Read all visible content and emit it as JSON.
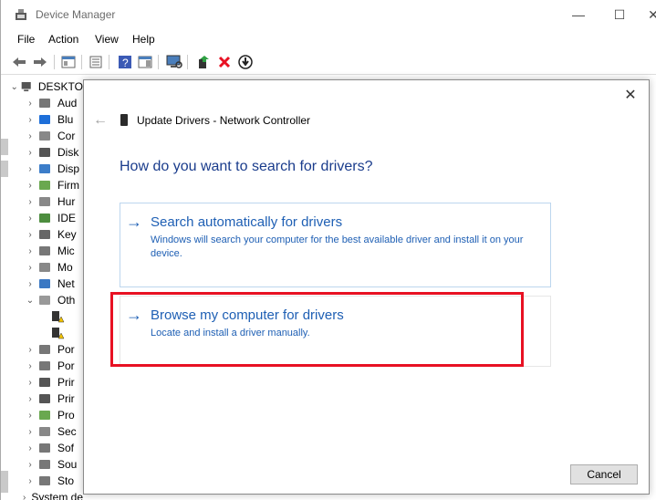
{
  "window": {
    "title": "Device Manager",
    "controls": {
      "minimize": "—",
      "maximize": "☐",
      "close": "✕"
    }
  },
  "menu": [
    "File",
    "Action",
    "View",
    "Help"
  ],
  "tree": {
    "root": "DESKTO",
    "items": [
      {
        "label": "Aud",
        "expanded": false
      },
      {
        "label": "Blu",
        "expanded": false
      },
      {
        "label": "Cor",
        "expanded": false
      },
      {
        "label": "Disk",
        "expanded": false
      },
      {
        "label": "Disp",
        "expanded": false
      },
      {
        "label": "Firm",
        "expanded": false
      },
      {
        "label": "Hur",
        "expanded": false
      },
      {
        "label": "IDE",
        "expanded": false
      },
      {
        "label": "Key",
        "expanded": false
      },
      {
        "label": "Mic",
        "expanded": false
      },
      {
        "label": "Mo",
        "expanded": false
      },
      {
        "label": "Net",
        "expanded": false
      },
      {
        "label": "Oth",
        "expanded": true
      },
      {
        "label": "",
        "child": true
      },
      {
        "label": "",
        "child": true
      },
      {
        "label": "Por",
        "expanded": false
      },
      {
        "label": "Por",
        "expanded": false
      },
      {
        "label": "Prir",
        "expanded": false
      },
      {
        "label": "Prir",
        "expanded": false
      },
      {
        "label": "Pro",
        "expanded": false
      },
      {
        "label": "Sec",
        "expanded": false
      },
      {
        "label": "Sof",
        "expanded": false
      },
      {
        "label": "Sou",
        "expanded": false
      },
      {
        "label": "Sto",
        "expanded": false
      },
      {
        "label": "System devices",
        "expanded": false
      }
    ]
  },
  "dialog": {
    "title": "Update Drivers - Network Controller",
    "heading": "How do you want to search for drivers?",
    "close": "✕",
    "back": "←",
    "options": {
      "auto": {
        "arrow": "→",
        "title": "Search automatically for drivers",
        "desc": "Windows will search your computer for the best available driver and install it on your device."
      },
      "browse": {
        "arrow": "→",
        "title": "Browse my computer for drivers",
        "desc": "Locate and install a driver manually."
      }
    },
    "cancel": "Cancel"
  },
  "colors": {
    "link_blue": "#1e5fb4",
    "highlight_red": "#e81123",
    "heading_blue": "#1a3c8c"
  },
  "icons": [
    "device-manager-icon",
    "back-arrow-icon",
    "forward-arrow-icon",
    "properties-icon",
    "help-icon",
    "scan-icon",
    "enable-device-icon",
    "uninstall-x-icon",
    "download-icon"
  ]
}
